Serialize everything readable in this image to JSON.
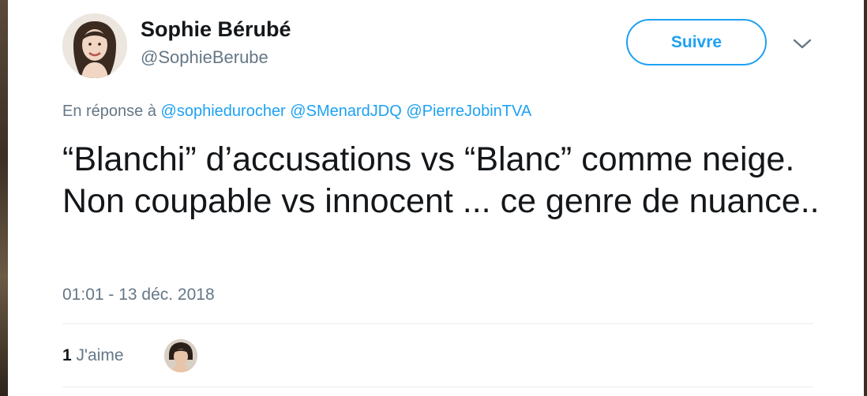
{
  "author": {
    "name": "Sophie Bérubé",
    "handle": "@SophieBerube"
  },
  "follow_button": {
    "label": "Suivre"
  },
  "reply": {
    "prefix": "En réponse à",
    "mentions": [
      "@sophiedurocher",
      "@SMenardJDQ",
      "@PierreJobinTVA"
    ]
  },
  "tweet": {
    "text": "“Blanchi” d’accusations vs “Blanc” comme neige. Non coupable vs innocent ... ce genre de nuance.."
  },
  "timestamp": "01:01 - 13 déc. 2018",
  "stats": {
    "likes_count": "1",
    "likes_label": "J'aime"
  },
  "colors": {
    "accent": "#1da1f2",
    "muted": "#657786",
    "text": "#14171a",
    "divider": "#e6ecf0"
  },
  "icons": {
    "menu": "chevron-down-icon"
  }
}
